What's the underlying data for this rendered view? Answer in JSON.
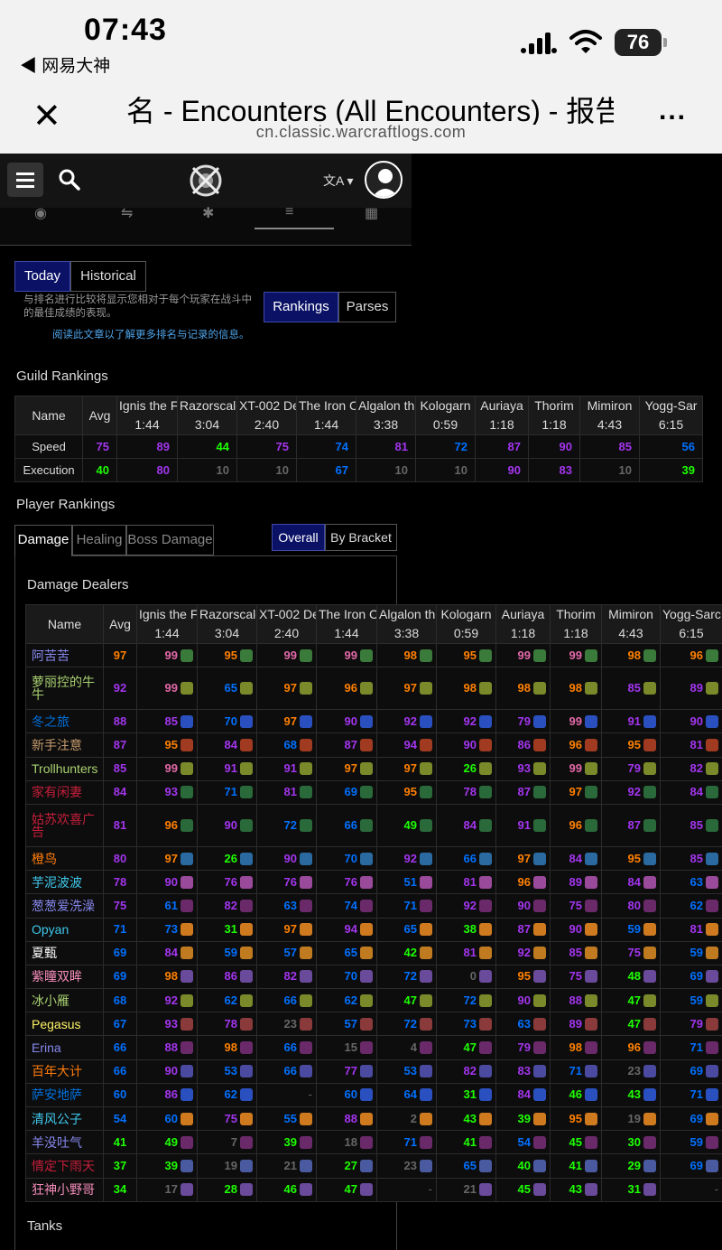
{
  "status_bar": {
    "time": "07:43",
    "back_app": "◀ 网易大神",
    "battery": "76"
  },
  "browser": {
    "title": "名 - Encounters (All Encounters) - 报告",
    "url": "cn.classic.warcraftlogs.com",
    "more": "..."
  },
  "mode_tabs": [
    "Today",
    "Historical"
  ],
  "hint": "与排名进行比较将显示您相对于每个玩家在战斗中的最佳成绩的表现。",
  "hint_link": "阅读此文章以了解更多排名与记录的信息。",
  "view_tabs": [
    "Rankings",
    "Parses"
  ],
  "guild_rankings": {
    "title": "Guild Rankings",
    "name_header": "Name",
    "avg_header": "Avg",
    "bosses": [
      {
        "name": "Ignis the F",
        "time": "1:44"
      },
      {
        "name": "Razorscale",
        "time": "3:04"
      },
      {
        "name": "XT-002 De",
        "time": "2:40"
      },
      {
        "name": "The Iron C",
        "time": "1:44"
      },
      {
        "name": "Algalon th",
        "time": "3:38"
      },
      {
        "name": "Kologarn",
        "time": "0:59"
      },
      {
        "name": "Auriaya",
        "time": "1:18"
      },
      {
        "name": "Thorim",
        "time": "1:18"
      },
      {
        "name": "Mimiron",
        "time": "4:43"
      },
      {
        "name": "Yogg-Sar",
        "time": "6:15"
      }
    ],
    "rows": [
      {
        "label": "Speed",
        "avg": 75,
        "scores": [
          89,
          44,
          75,
          74,
          81,
          72,
          87,
          90,
          85,
          56
        ]
      },
      {
        "label": "Execution",
        "avg": 40,
        "scores": [
          80,
          10,
          10,
          67,
          10,
          10,
          90,
          83,
          10,
          39
        ]
      }
    ]
  },
  "player_rankings": {
    "title": "Player Rankings",
    "role_tabs": [
      "Damage",
      "Healing",
      "Boss Damage"
    ],
    "bracket_tabs": [
      "Overall",
      "By Bracket"
    ],
    "section_title": "Damage Dealers",
    "next_section": "Tanks",
    "name_header": "Name",
    "avg_header": "Avg",
    "bosses": [
      {
        "name": "Ignis the F",
        "time": "1:44"
      },
      {
        "name": "Razorscale",
        "time": "3:04"
      },
      {
        "name": "XT-002 De",
        "time": "2:40"
      },
      {
        "name": "The Iron C",
        "time": "1:44"
      },
      {
        "name": "Algalon th",
        "time": "3:38"
      },
      {
        "name": "Kologarn",
        "time": "0:59"
      },
      {
        "name": "Auriaya",
        "time": "1:18"
      },
      {
        "name": "Thorim",
        "time": "1:18"
      },
      {
        "name": "Mimiron",
        "time": "4:43"
      },
      {
        "name": "Yogg-Sarc",
        "time": "6:15"
      }
    ],
    "players": [
      {
        "name": "阿苦苦",
        "class_color": "#8788ee",
        "icon_color": "#3a7a3a",
        "avg": 97,
        "scores": [
          99,
          95,
          99,
          99,
          98,
          95,
          99,
          99,
          98,
          96
        ]
      },
      {
        "name": "萝丽控的牛牛",
        "class_color": "#a9d271",
        "icon_color": "#7a8a2a",
        "avg": 92,
        "scores": [
          99,
          65,
          97,
          96,
          97,
          98,
          98,
          98,
          85,
          89
        ]
      },
      {
        "name": "冬之旅",
        "class_color": "#0070dd",
        "icon_color": "#2a50c0",
        "avg": 88,
        "scores": [
          85,
          70,
          97,
          90,
          92,
          92,
          79,
          99,
          91,
          90
        ]
      },
      {
        "name": "新手注意",
        "class_color": "#c69b6d",
        "icon_color": "#a03a20",
        "avg": 87,
        "scores": [
          95,
          84,
          68,
          87,
          94,
          90,
          86,
          96,
          95,
          81
        ]
      },
      {
        "name": "Trollhunters",
        "class_color": "#a9d271",
        "icon_color": "#7a8a2a",
        "avg": 85,
        "scores": [
          99,
          91,
          91,
          97,
          97,
          26,
          93,
          99,
          79,
          82
        ]
      },
      {
        "name": "家有闲妻",
        "class_color": "#c41e3a",
        "icon_color": "#2a6a3a",
        "avg": 84,
        "scores": [
          93,
          71,
          81,
          69,
          95,
          78,
          87,
          97,
          92,
          84
        ]
      },
      {
        "name": "姑苏欢喜广告",
        "class_color": "#c41e3a",
        "icon_color": "#2a6a3a",
        "avg": 81,
        "scores": [
          96,
          90,
          72,
          66,
          49,
          84,
          91,
          96,
          87,
          85
        ]
      },
      {
        "name": "橙鸟",
        "class_color": "#ff7c0a",
        "icon_color": "#2a6aa0",
        "avg": 80,
        "scores": [
          97,
          26,
          90,
          70,
          92,
          66,
          97,
          84,
          95,
          85
        ]
      },
      {
        "name": "芋泥波波",
        "class_color": "#3fc7eb",
        "icon_color": "#9a4a9a",
        "avg": 78,
        "scores": [
          90,
          76,
          76,
          76,
          51,
          81,
          96,
          89,
          84,
          63
        ]
      },
      {
        "name": "葱葱爱洗澡",
        "class_color": "#8788ee",
        "icon_color": "#6a2a6a",
        "avg": 75,
        "scores": [
          61,
          82,
          63,
          74,
          71,
          92,
          90,
          75,
          80,
          62
        ]
      },
      {
        "name": "Opyan",
        "class_color": "#3fc7eb",
        "icon_color": "#d07a20",
        "avg": 71,
        "scores": [
          73,
          31,
          97,
          94,
          65,
          38,
          87,
          90,
          59,
          81
        ]
      },
      {
        "name": "夏甄",
        "class_color": "#ffffff",
        "icon_color": "#c07a20",
        "avg": 69,
        "scores": [
          84,
          59,
          57,
          65,
          42,
          81,
          92,
          85,
          75,
          59
        ]
      },
      {
        "name": "紫瞳双眸",
        "class_color": "#f48cba",
        "icon_color": "#6a4a9a",
        "avg": 69,
        "scores": [
          98,
          86,
          82,
          70,
          72,
          0,
          95,
          75,
          48,
          69
        ]
      },
      {
        "name": "冰小雁",
        "class_color": "#a9d271",
        "icon_color": "#7a8a2a",
        "avg": 68,
        "scores": [
          92,
          62,
          66,
          62,
          47,
          72,
          90,
          88,
          47,
          59
        ]
      },
      {
        "name": "Pegasus",
        "class_color": "#fff468",
        "icon_color": "#8a3a3a",
        "avg": 67,
        "scores": [
          93,
          78,
          23,
          57,
          72,
          73,
          63,
          89,
          47,
          79
        ]
      },
      {
        "name": "Erina",
        "class_color": "#8788ee",
        "icon_color": "#6a2a6a",
        "avg": 66,
        "scores": [
          88,
          98,
          66,
          15,
          4,
          47,
          79,
          98,
          96,
          71
        ]
      },
      {
        "name": "百年大计",
        "class_color": "#ff7c0a",
        "icon_color": "#4a4aa0",
        "avg": 66,
        "scores": [
          90,
          53,
          66,
          77,
          53,
          82,
          83,
          71,
          23,
          69
        ]
      },
      {
        "name": "萨安地萨",
        "class_color": "#0070dd",
        "icon_color": "#2a50c0",
        "avg": 60,
        "scores": [
          86,
          62,
          null,
          60,
          64,
          31,
          84,
          46,
          43,
          71
        ]
      },
      {
        "name": "清风公子",
        "class_color": "#3fc7eb",
        "icon_color": "#d07a20",
        "avg": 54,
        "scores": [
          60,
          75,
          55,
          88,
          2,
          43,
          39,
          95,
          19,
          69
        ]
      },
      {
        "name": "羊没吐气",
        "class_color": "#8788ee",
        "icon_color": "#6a2a6a",
        "avg": 41,
        "scores": [
          49,
          7,
          39,
          18,
          71,
          41,
          54,
          45,
          30,
          59
        ]
      },
      {
        "name": "情定下雨天",
        "class_color": "#c41e3a",
        "icon_color": "#4a5aa0",
        "avg": 37,
        "scores": [
          39,
          19,
          21,
          27,
          23,
          65,
          40,
          41,
          29,
          69
        ]
      },
      {
        "name": "狂神小野哥",
        "class_color": "#f48cba",
        "icon_color": "#6a4a9a",
        "avg": 34,
        "scores": [
          17,
          28,
          46,
          47,
          null,
          21,
          45,
          43,
          31,
          null
        ]
      }
    ]
  },
  "colors": {
    "legendary": "#ff8000",
    "astounding": "#e268a8",
    "epic": "#a335ee",
    "rare": "#0070ff",
    "uncommon": "#1eff00",
    "common": "#666666",
    "active_tab": "#0b1266"
  }
}
